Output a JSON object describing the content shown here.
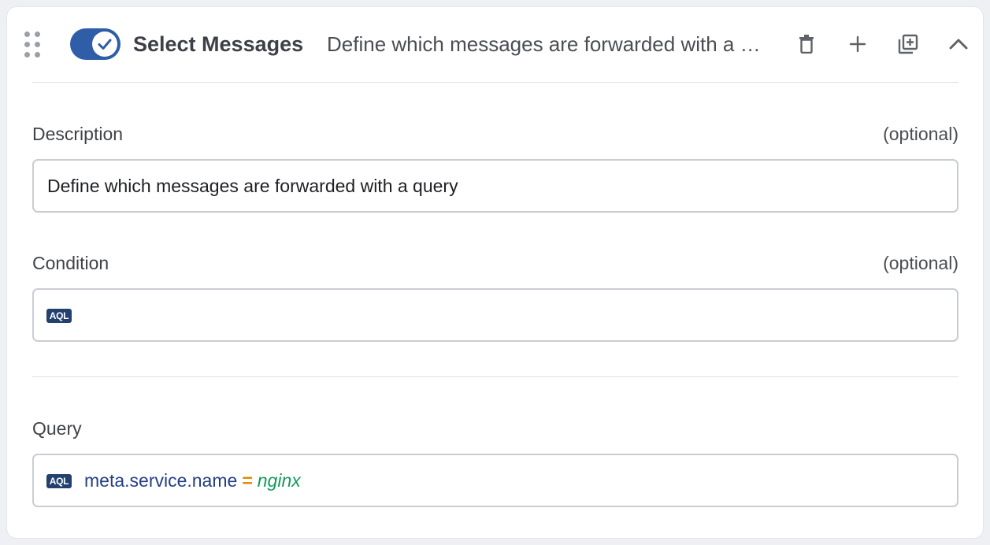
{
  "header": {
    "title": "Select Messages",
    "subtitle": "Define which messages are forwarded with a query",
    "toggle_on": true
  },
  "description": {
    "label": "Description",
    "optional": "(optional)",
    "value": "Define which messages are forwarded with a query"
  },
  "condition": {
    "label": "Condition",
    "optional": "(optional)",
    "badge": "AQL",
    "value": ""
  },
  "query": {
    "label": "Query",
    "badge": "AQL",
    "field": "meta.service.name",
    "operator": "=",
    "value": "nginx"
  },
  "colors": {
    "toggle": "#2f5da8",
    "aql_badge": "#23406f",
    "query_field": "#233f86",
    "query_operator": "#e08a00",
    "query_value": "#149a5c"
  },
  "icons": {
    "drag": "drag-handle-icon",
    "check": "check-icon",
    "delete": "trash-icon",
    "add": "plus-icon",
    "duplicate": "duplicate-icon",
    "collapse": "chevron-up-icon"
  }
}
